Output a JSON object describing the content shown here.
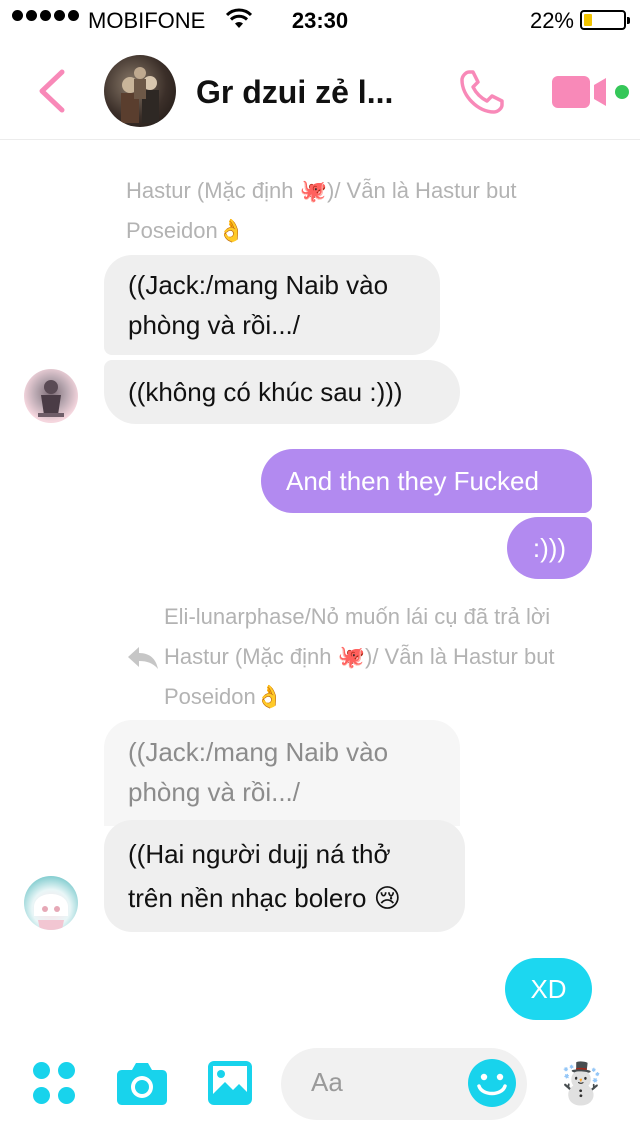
{
  "status_bar": {
    "carrier": "MOBIFONE",
    "time": "23:30",
    "battery": "22%",
    "battery_level": 0.22
  },
  "header": {
    "title": "Gr dzui zẻ l...",
    "accent_color": "#f889b8"
  },
  "messages": [
    {
      "type": "reply_info",
      "text_line1": "Hastur (Mặc định 🐙)/ Vẫn là Hastur but",
      "text_line2": "Poseidon👌"
    },
    {
      "type": "incoming",
      "text_line1": "((Jack:/mang Naib vào",
      "text_line2": "phòng và rồi.../"
    },
    {
      "type": "incoming",
      "text": "((không có khúc sau :)))"
    },
    {
      "type": "outgoing",
      "text": "And then they Fucked"
    },
    {
      "type": "outgoing",
      "text": ":)))"
    },
    {
      "type": "reply_info",
      "text_line1": "Eli-lunarphase/Nỏ muốn lái cụ đã trả lời",
      "text_line2": "Hastur (Mặc định 🐙)/ Vẫn là Hastur but",
      "text_line3": "Poseidon👌"
    },
    {
      "type": "quoted",
      "text_line1": "((Jack:/mang Naib vào",
      "text_line2": "phòng và rồi.../"
    },
    {
      "type": "incoming",
      "text_line1": "((Hai người dujj ná thở",
      "text_line2": "trên nền nhạc bolero 😢"
    },
    {
      "type": "outgoing_blue",
      "text": "XD"
    }
  ],
  "composer": {
    "placeholder": "Aa",
    "sticker": "☃️",
    "icon_color": "#18d3ec"
  }
}
